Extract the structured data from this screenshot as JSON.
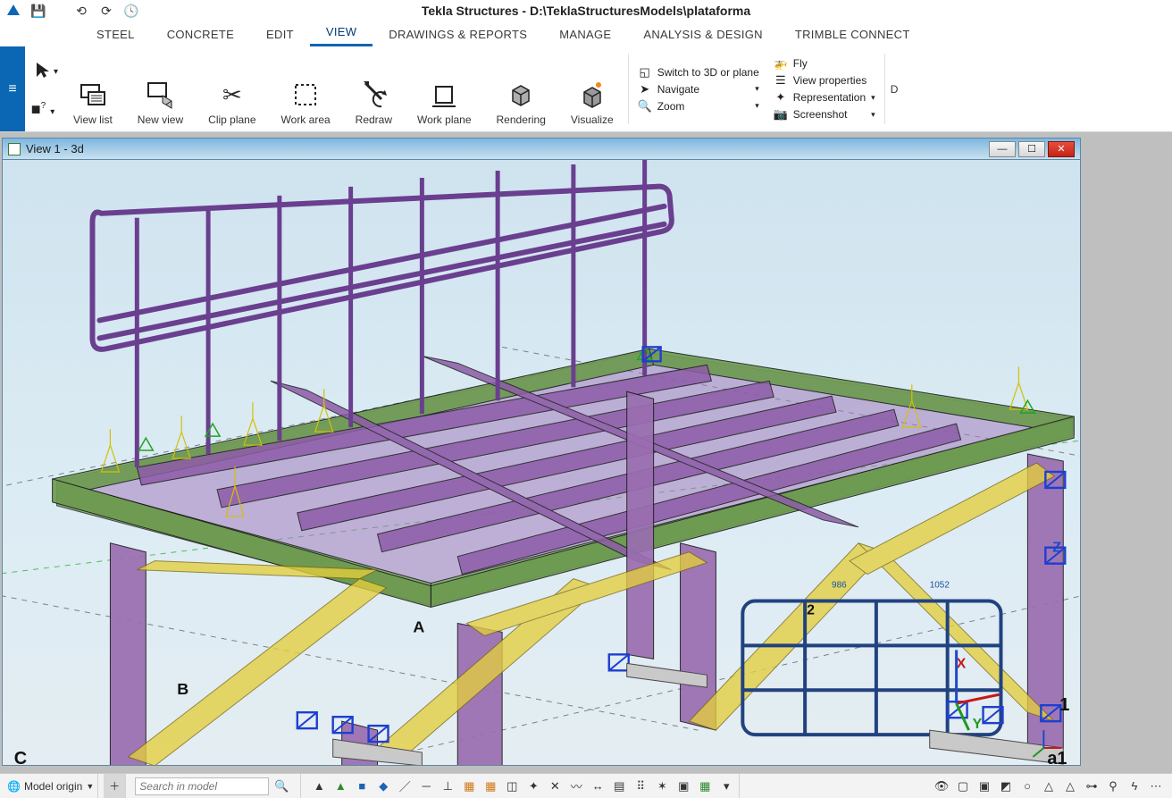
{
  "app": {
    "title": "Tekla Structures - D:\\TeklaStructuresModels\\plataforma"
  },
  "menu": {
    "tabs": [
      "STEEL",
      "CONCRETE",
      "EDIT",
      "VIEW",
      "DRAWINGS & REPORTS",
      "MANAGE",
      "ANALYSIS & DESIGN",
      "TRIMBLE CONNECT"
    ],
    "active": "VIEW"
  },
  "ribbon": {
    "view_list": "View list",
    "new_view": "New view",
    "clip_plane": "Clip plane",
    "work_area": "Work area",
    "redraw": "Redraw",
    "work_plane": "Work plane",
    "rendering": "Rendering",
    "visualize": "Visualize",
    "side1": {
      "switch3d": "Switch to 3D or plane",
      "navigate": "Navigate",
      "zoom": "Zoom"
    },
    "side2": {
      "fly": "Fly",
      "viewprops": "View properties",
      "representation": "Representation",
      "screenshot": "Screenshot"
    },
    "trunc": "D"
  },
  "view": {
    "title": "View 1 - 3d",
    "axis": {
      "x": "X",
      "y": "Y",
      "z": "Z"
    },
    "labels": {
      "a": "A",
      "b": "B",
      "c": "C",
      "a1": "a1",
      "two": "2"
    }
  },
  "status": {
    "origin": "Model origin",
    "search_placeholder": "Search in model"
  }
}
